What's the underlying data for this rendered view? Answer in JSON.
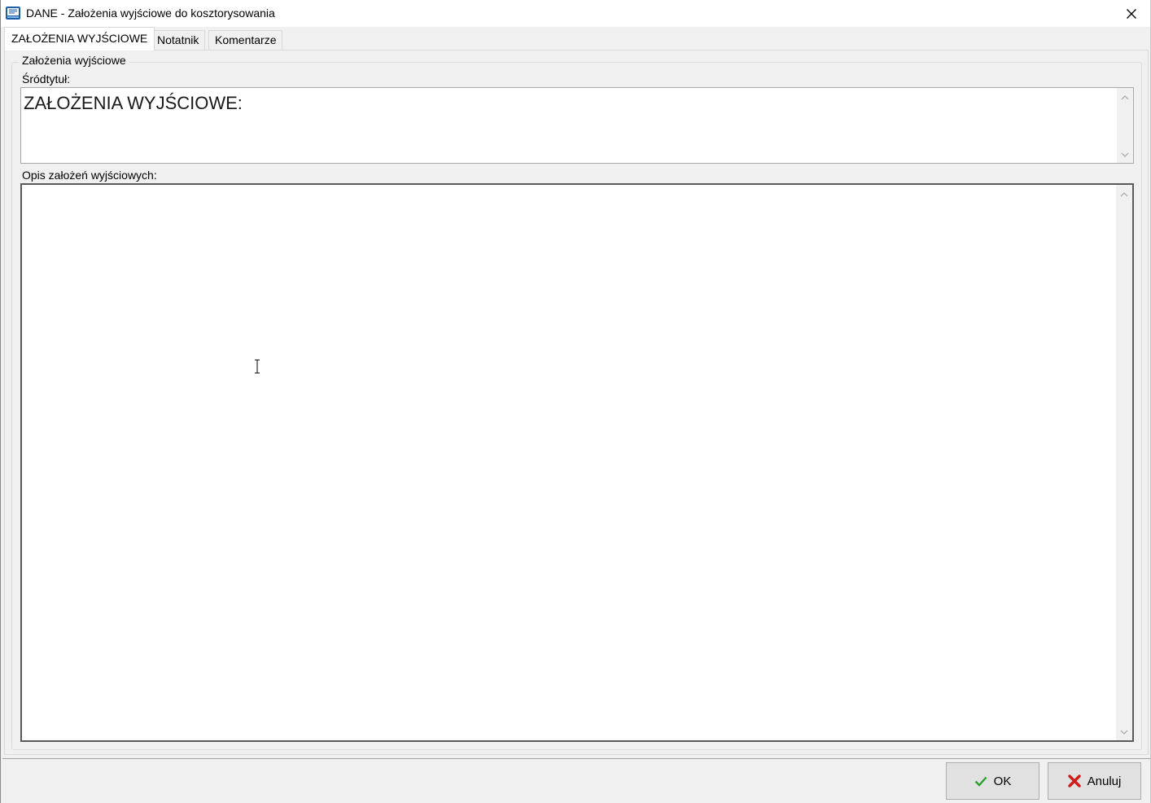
{
  "window": {
    "title": "DANE - Założenia wyjściowe do kosztorysowania",
    "icon": "app-book-icon",
    "close_icon": "close-icon"
  },
  "tabs": [
    {
      "label": "ZAŁOŻENIA WYJŚCIOWE",
      "active": true
    },
    {
      "label": "Notatnik",
      "active": false
    },
    {
      "label": "Komentarze",
      "active": false
    }
  ],
  "group": {
    "title": "Założenia wyjściowe",
    "subtitle_label": "Śródtytuł:",
    "subtitle_value": "ZAŁOŻENIA WYJŚCIOWE:",
    "description_label": "Opis założeń wyjściowych:",
    "description_value": ""
  },
  "buttons": {
    "ok_label": "OK",
    "ok_icon": "check-icon",
    "ok_color": "#2e9e2e",
    "cancel_label": "Anuluj",
    "cancel_icon": "x-icon",
    "cancel_color": "#d11b1b"
  }
}
